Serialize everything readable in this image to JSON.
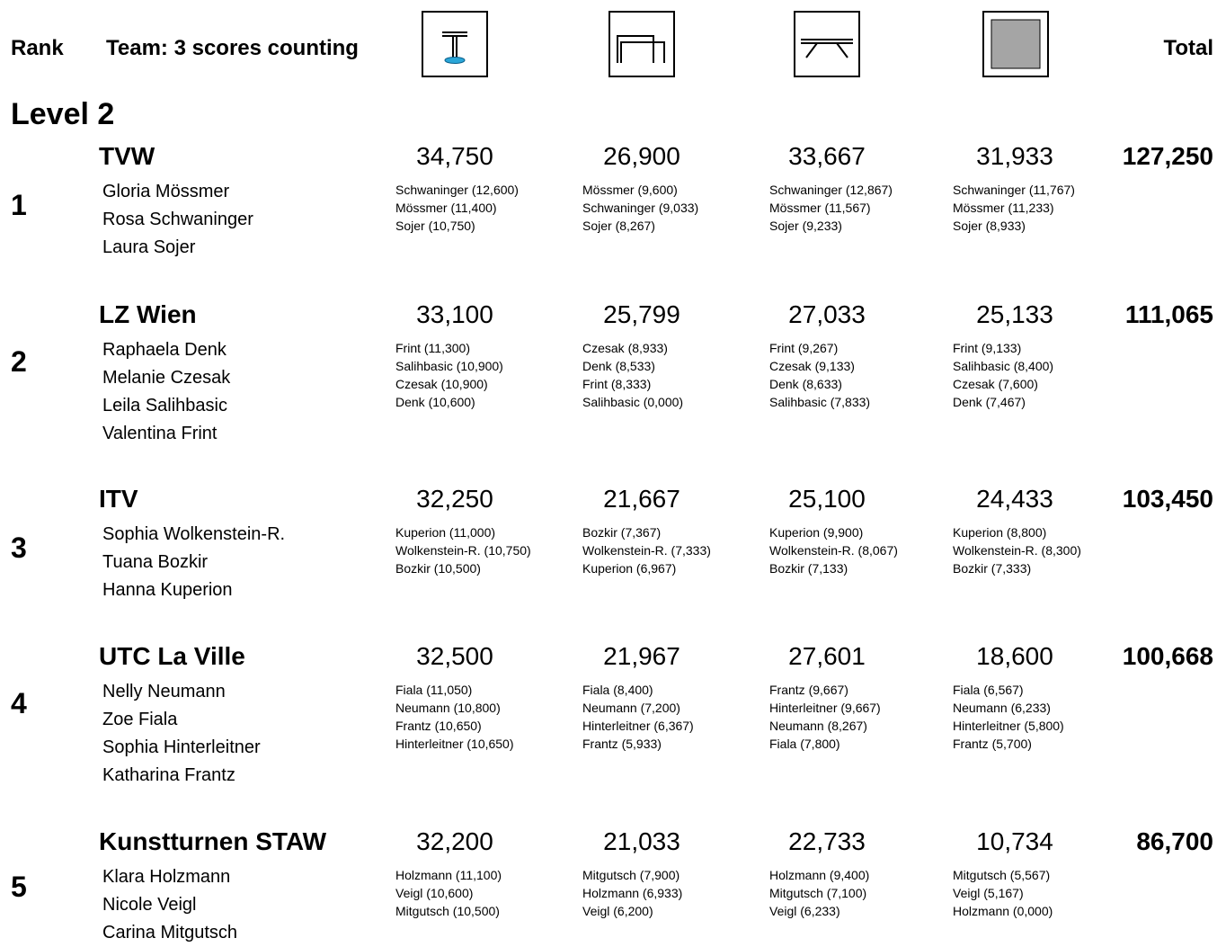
{
  "header": {
    "rank_label": "Rank",
    "team_label": "Team:  3  scores counting",
    "total_label": "Total",
    "apparatus_icons": [
      "vault-icon",
      "uneven-bars-icon",
      "balance-beam-icon",
      "floor-icon"
    ]
  },
  "level_title": "Level 2",
  "teams": [
    {
      "rank": "1",
      "name": "TVW",
      "total": "127,250",
      "members": [
        "Gloria Mössmer",
        "Rosa Schwaninger",
        "Laura Sojer"
      ],
      "apparatus": [
        {
          "score": "34,750",
          "details": [
            "Schwaninger (12,600)",
            "Mössmer (11,400)",
            "Sojer (10,750)"
          ]
        },
        {
          "score": "26,900",
          "details": [
            "Mössmer (9,600)",
            "Schwaninger (9,033)",
            "Sojer (8,267)"
          ]
        },
        {
          "score": "33,667",
          "details": [
            "Schwaninger (12,867)",
            "Mössmer (11,567)",
            "Sojer (9,233)"
          ]
        },
        {
          "score": "31,933",
          "details": [
            "Schwaninger (11,767)",
            "Mössmer (11,233)",
            "Sojer (8,933)"
          ]
        }
      ]
    },
    {
      "rank": "2",
      "name": "LZ Wien",
      "total": "111,065",
      "members": [
        "Raphaela Denk",
        "Melanie Czesak",
        "Leila Salihbasic",
        "Valentina Frint"
      ],
      "apparatus": [
        {
          "score": "33,100",
          "details": [
            "Frint (11,300)",
            "Salihbasic (10,900)",
            "Czesak (10,900)",
            "Denk (10,600)"
          ]
        },
        {
          "score": "25,799",
          "details": [
            "Czesak (8,933)",
            "Denk (8,533)",
            "Frint (8,333)",
            "Salihbasic (0,000)"
          ]
        },
        {
          "score": "27,033",
          "details": [
            "Frint (9,267)",
            "Czesak (9,133)",
            "Denk (8,633)",
            "Salihbasic (7,833)"
          ]
        },
        {
          "score": "25,133",
          "details": [
            "Frint (9,133)",
            "Salihbasic (8,400)",
            "Czesak (7,600)",
            "Denk (7,467)"
          ]
        }
      ]
    },
    {
      "rank": "3",
      "name": "ITV",
      "total": "103,450",
      "members": [
        "Sophia Wolkenstein-R.",
        "Tuana Bozkir",
        "Hanna Kuperion"
      ],
      "apparatus": [
        {
          "score": "32,250",
          "details": [
            "Kuperion (11,000)",
            "Wolkenstein-R. (10,750)",
            "Bozkir (10,500)"
          ]
        },
        {
          "score": "21,667",
          "details": [
            "Bozkir (7,367)",
            "Wolkenstein-R. (7,333)",
            "Kuperion (6,967)"
          ]
        },
        {
          "score": "25,100",
          "details": [
            "Kuperion (9,900)",
            "Wolkenstein-R. (8,067)",
            "Bozkir (7,133)"
          ]
        },
        {
          "score": "24,433",
          "details": [
            "Kuperion (8,800)",
            "Wolkenstein-R. (8,300)",
            "Bozkir (7,333)"
          ]
        }
      ]
    },
    {
      "rank": "4",
      "name": "UTC La Ville",
      "total": "100,668",
      "members": [
        "Nelly Neumann",
        "Zoe Fiala",
        "Sophia Hinterleitner",
        "Katharina Frantz"
      ],
      "apparatus": [
        {
          "score": "32,500",
          "details": [
            "Fiala (11,050)",
            "Neumann (10,800)",
            "Frantz (10,650)",
            "Hinterleitner (10,650)"
          ]
        },
        {
          "score": "21,967",
          "details": [
            "Fiala (8,400)",
            "Neumann (7,200)",
            "Hinterleitner (6,367)",
            "Frantz (5,933)"
          ]
        },
        {
          "score": "27,601",
          "details": [
            "Frantz (9,667)",
            "Hinterleitner (9,667)",
            "Neumann (8,267)",
            "Fiala (7,800)"
          ]
        },
        {
          "score": "18,600",
          "details": [
            "Fiala (6,567)",
            "Neumann (6,233)",
            "Hinterleitner (5,800)",
            "Frantz (5,700)"
          ]
        }
      ]
    },
    {
      "rank": "5",
      "name": "Kunstturnen STAW",
      "total": "86,700",
      "members": [
        "Klara Holzmann",
        "Nicole Veigl",
        "Carina Mitgutsch"
      ],
      "apparatus": [
        {
          "score": "32,200",
          "details": [
            "Holzmann (11,100)",
            "Veigl (10,600)",
            "Mitgutsch (10,500)"
          ]
        },
        {
          "score": "21,033",
          "details": [
            "Mitgutsch (7,900)",
            "Holzmann (6,933)",
            "Veigl (6,200)"
          ]
        },
        {
          "score": "22,733",
          "details": [
            "Holzmann (9,400)",
            "Mitgutsch (7,100)",
            "Veigl (6,233)"
          ]
        },
        {
          "score": "10,734",
          "details": [
            "Mitgutsch (5,567)",
            "Veigl (5,167)",
            "Holzmann (0,000)"
          ]
        }
      ]
    }
  ]
}
